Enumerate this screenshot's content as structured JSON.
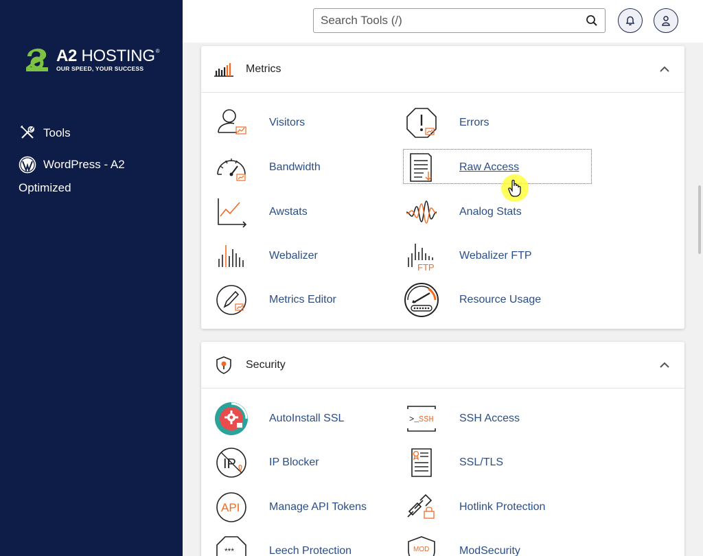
{
  "brand": {
    "name": "A2 HOSTING",
    "name_bold": "A2",
    "name_thin": "HOSTING",
    "registered": "®",
    "tagline": "OUR SPEED, YOUR SUCCESS",
    "colors": {
      "sidebar": "#0e1d47",
      "logo_green": "#7dc242",
      "link": "#2a4e87",
      "accent_orange": "#f26a22"
    }
  },
  "sidebar": {
    "items": [
      {
        "label": "Tools",
        "icon": "tools-icon"
      },
      {
        "label": "WordPress - A2",
        "label_cont": "Optimized",
        "icon": "wordpress-icon"
      }
    ]
  },
  "header": {
    "search_placeholder": "Search Tools (/)",
    "notifications_icon": "bell-icon",
    "account_icon": "user-icon"
  },
  "metrics": {
    "title": "Metrics",
    "icon": "bar-chart-icon",
    "items": [
      {
        "label": "Visitors",
        "icon": "visitors-icon"
      },
      {
        "label": "Errors",
        "icon": "errors-icon"
      },
      {
        "label": "Bandwidth",
        "icon": "bandwidth-icon"
      },
      {
        "label": "Raw Access",
        "icon": "raw-access-icon"
      },
      {
        "label": "Awstats",
        "icon": "awstats-icon"
      },
      {
        "label": "Analog Stats",
        "icon": "analog-stats-icon"
      },
      {
        "label": "Webalizer",
        "icon": "webalizer-icon"
      },
      {
        "label": "Webalizer FTP",
        "icon": "webalizer-ftp-icon",
        "icon_text": "FTP"
      },
      {
        "label": "Metrics Editor",
        "icon": "metrics-editor-icon"
      },
      {
        "label": "Resource Usage",
        "icon": "resource-usage-icon"
      }
    ]
  },
  "security": {
    "title": "Security",
    "icon": "shield-icon",
    "items": [
      {
        "label": "AutoInstall SSL",
        "icon": "autoinstall-ssl-icon"
      },
      {
        "label": "SSH Access",
        "icon": "ssh-access-icon",
        "icon_text": ">_SSH"
      },
      {
        "label": "IP Blocker",
        "icon": "ip-blocker-icon",
        "icon_text": "IP"
      },
      {
        "label": "SSL/TLS",
        "icon": "ssl-tls-icon"
      },
      {
        "label": "Manage API Tokens",
        "icon": "api-tokens-icon",
        "icon_text": "API"
      },
      {
        "label": "Hotlink Protection",
        "icon": "hotlink-protection-icon"
      },
      {
        "label": "Leech Protection",
        "icon": "leech-protection-icon",
        "icon_text": "***"
      },
      {
        "label": "ModSecurity",
        "icon": "modsecurity-icon",
        "icon_text": "MOD"
      }
    ]
  }
}
